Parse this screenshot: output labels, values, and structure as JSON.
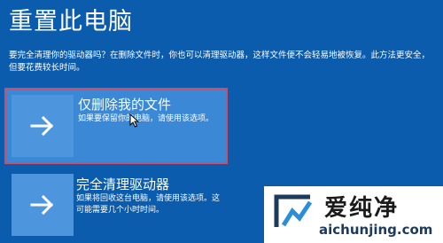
{
  "page": {
    "title": "重置此电脑",
    "description": "要完全清理你的驱动器吗？在删除文件时，你也可以清理驱动器，这样文件便不会轻易地被恢复。此方法更安全，但要花费较长时间。"
  },
  "options": [
    {
      "title": "仅删除我的文件",
      "description": "如果要保留你的电脑，请使用该选项。",
      "icon": "arrow-right-icon",
      "selected": true
    },
    {
      "title": "完全清理驱动器",
      "description": "如果将回收这台电脑，请使用该选项。这可能需要几个小时时间。",
      "icon": "arrow-right-icon",
      "selected": false
    }
  ],
  "watermark": {
    "name": "爱纯净",
    "url": "aichunjing.com"
  },
  "colors": {
    "background": "#0b5cad",
    "tile": "#4d96de",
    "selected_border": "#c8506a"
  }
}
